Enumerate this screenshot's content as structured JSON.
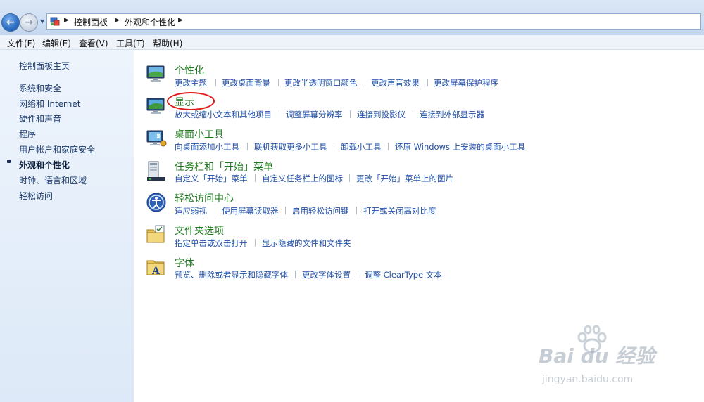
{
  "breadcrumb": {
    "items": [
      "控制面板",
      "外观和个性化"
    ]
  },
  "menu": [
    "文件(F)",
    "编辑(E)",
    "查看(V)",
    "工具(T)",
    "帮助(H)"
  ],
  "left_pane": {
    "home": "控制面板主页",
    "items": [
      "系统和安全",
      "网络和 Internet",
      "硬件和声音",
      "程序",
      "用户帐户和家庭安全",
      "外观和个性化",
      "时钟、语言和区域",
      "轻松访问"
    ],
    "current": "外观和个性化"
  },
  "categories": [
    {
      "title": "个性化",
      "icon": "monitor-icon",
      "links": [
        "更改主题",
        "更改桌面背景",
        "更改半透明窗口颜色",
        "更改声音效果",
        "更改屏幕保护程序"
      ]
    },
    {
      "title": "显示",
      "icon": "display-icon",
      "links": [
        "放大或缩小文本和其他项目",
        "调整屏幕分辨率",
        "连接到投影仪",
        "连接到外部显示器"
      ]
    },
    {
      "title": "桌面小工具",
      "icon": "gadgets-icon",
      "links": [
        "向桌面添加小工具",
        "联机获取更多小工具",
        "卸载小工具",
        "还原 Windows 上安装的桌面小工具"
      ]
    },
    {
      "title": "任务栏和「开始」菜单",
      "icon": "taskbar-icon",
      "links": [
        "自定义「开始」菜单",
        "自定义任务栏上的图标",
        "更改「开始」菜单上的图片"
      ]
    },
    {
      "title": "轻松访问中心",
      "icon": "ease-of-access-icon",
      "links": [
        "适应弱视",
        "使用屏幕读取器",
        "启用轻松访问键",
        "打开或关闭高对比度"
      ]
    },
    {
      "title": "文件夹选项",
      "icon": "folder-options-icon",
      "links": [
        "指定单击或双击打开",
        "显示隐藏的文件和文件夹"
      ]
    },
    {
      "title": "字体",
      "icon": "fonts-icon",
      "links": [
        "预览、删除或者显示和隐藏字体",
        "更改字体设置",
        "调整 ClearType 文本"
      ]
    }
  ],
  "watermark": {
    "text": "Bai du 经验",
    "url": "jingyan.baidu.com"
  },
  "colors": {
    "title_green": "#1e7a1e",
    "link_blue": "#1f4fa8",
    "highlight_red": "#e01818"
  }
}
